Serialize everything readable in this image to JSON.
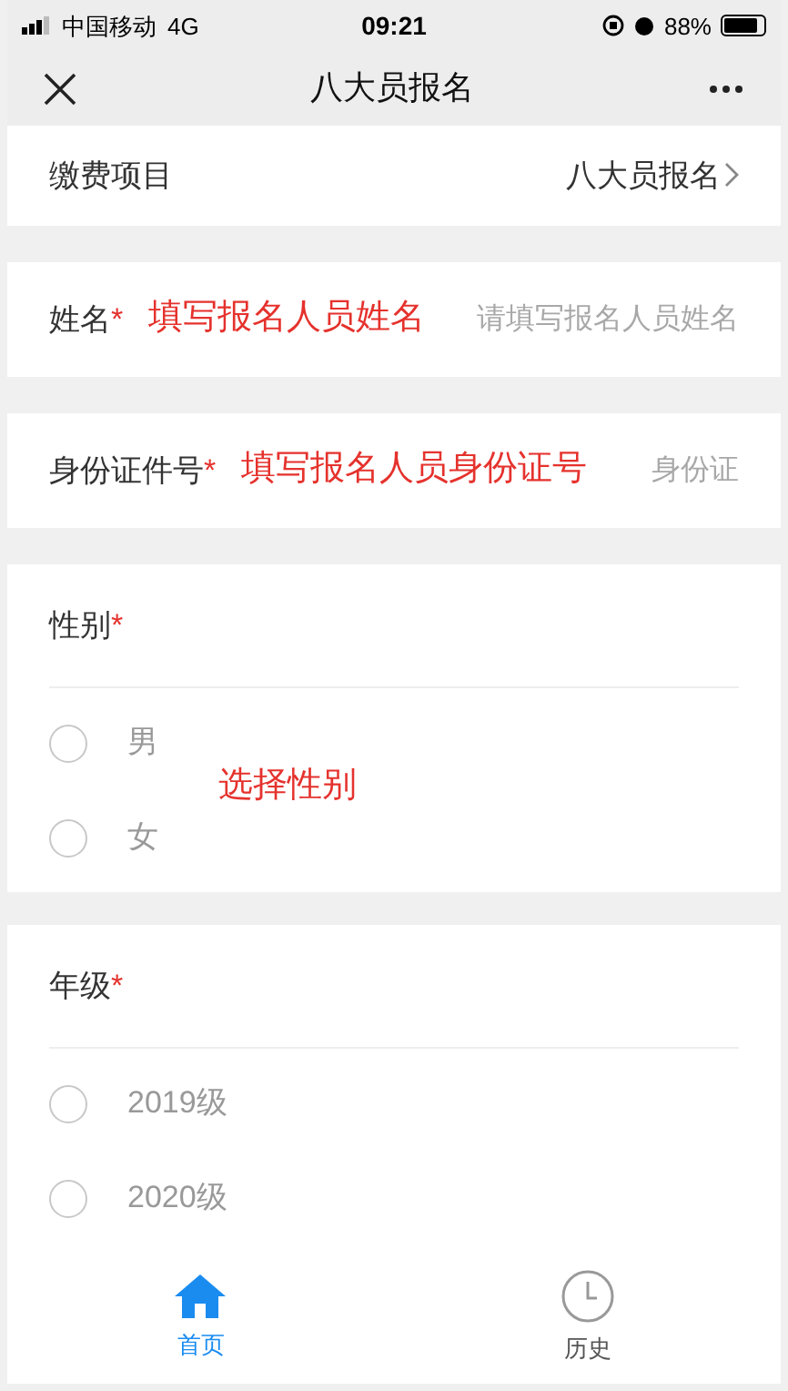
{
  "status_bar": {
    "carrier": "中国移动",
    "network": "4G",
    "time": "09:21",
    "battery": "88%"
  },
  "nav": {
    "title": "八大员报名"
  },
  "fee_item": {
    "label": "缴费项目",
    "value": "八大员报名"
  },
  "fields": [
    {
      "label": "姓名",
      "required_mark": "*",
      "annotation": "填写报名人员姓名",
      "placeholder": "请填写报名人员姓名"
    },
    {
      "label": "身份证件号",
      "required_mark": "*",
      "annotation": "填写报名人员身份证号",
      "placeholder": "身份证"
    }
  ],
  "groups": [
    {
      "label": "性别",
      "required_mark": "*",
      "annotation": "选择性别",
      "options": [
        {
          "label": "男",
          "selected": false
        },
        {
          "label": "女",
          "selected": false
        }
      ]
    },
    {
      "label": "年级",
      "required_mark": "*",
      "options": [
        {
          "label": "2019级",
          "selected": false
        },
        {
          "label": "2020级",
          "selected": false
        }
      ]
    }
  ],
  "tabs": [
    {
      "label": "首页",
      "kind": "home",
      "selected": true
    },
    {
      "label": "历史",
      "kind": "history",
      "selected": false
    }
  ]
}
